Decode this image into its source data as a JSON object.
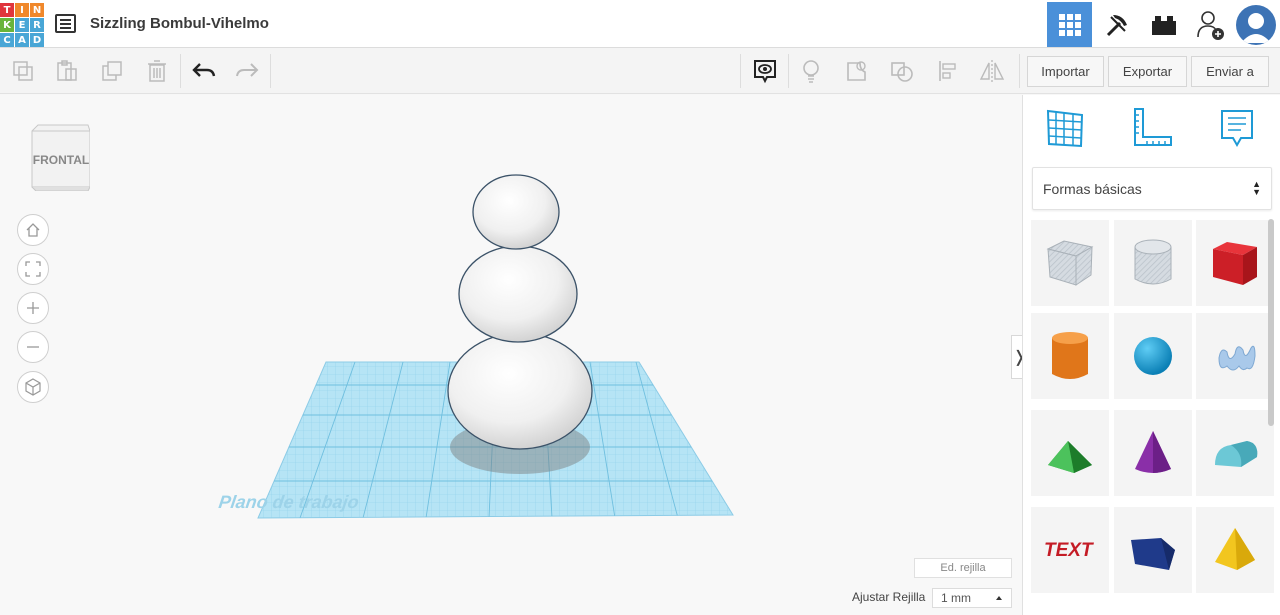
{
  "header": {
    "logo_letters": [
      "T",
      "I",
      "N",
      "K",
      "E",
      "R",
      "C",
      "A",
      "D"
    ],
    "logo_colors": [
      "#e0353d",
      "#f0882b",
      "#f0882b",
      "#69b43a",
      "#49a6d6",
      "#49a6d6",
      "#49a6d6",
      "#49a6d6",
      "#49a6d6"
    ],
    "project_title": "Sizzling Bombul-Vihelmo",
    "accent": "#4a90d9"
  },
  "toolbar": {
    "import_label": "Importar",
    "export_label": "Exportar",
    "send_label": "Enviar a"
  },
  "viewport": {
    "viewcube_label": "FRONTAL",
    "workplane_label": "Plano de trabajo",
    "edit_grid_label": "Ed. rejilla",
    "snap_label": "Ajustar Rejilla",
    "snap_value": "1 mm"
  },
  "panel": {
    "category": "Formas básicas",
    "shapes": [
      "Box hole",
      "Cylinder hole",
      "Box",
      "Cylinder",
      "Sphere",
      "Scribble",
      "Roof",
      "Cone",
      "Round roof",
      "Text",
      "Polygon",
      "Pyramid"
    ]
  }
}
